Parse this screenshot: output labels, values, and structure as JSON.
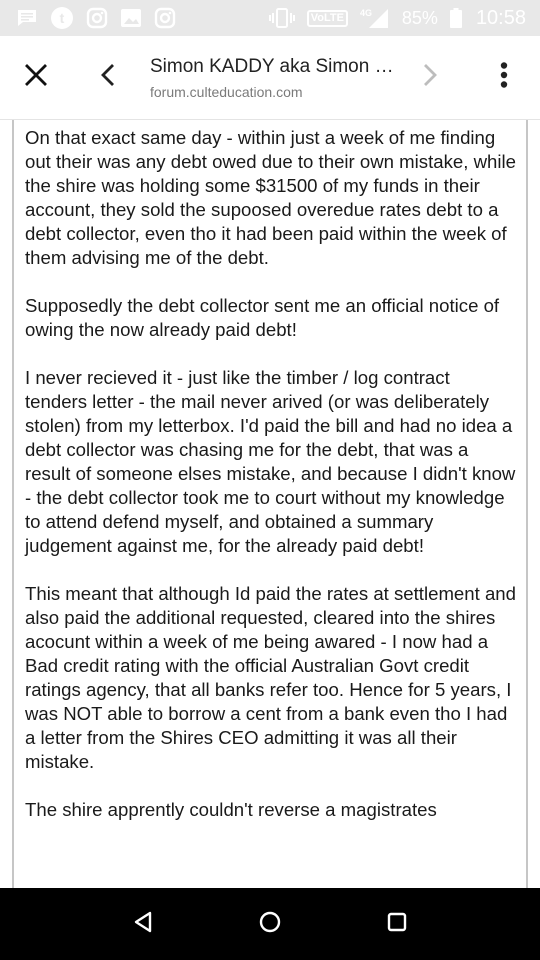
{
  "status_bar": {
    "icons": [
      "message-icon",
      "tumblr-icon",
      "instagram-icon",
      "image-icon",
      "instagram-icon",
      "vibrate-icon",
      "volte-badge",
      "signal-4g-icon",
      "battery-icon"
    ],
    "volte": "VoLTE",
    "network": "4G",
    "battery": "85%",
    "time": "10:58"
  },
  "toolbar": {
    "title": "Simon KADDY aka Simon KADDY",
    "url": "forum.culteducation.com"
  },
  "post": {
    "paragraphs": [
      "On that exact same day - within just a week of me finding out their was any debt owed due to their own mistake, while the shire was holding some $31500 of my funds in their account, they sold the supoosed overedue rates debt to a debt collector, even tho it had been paid within the week of them advising me of the debt.",
      "Supposedly the debt collector sent me an official notice of owing the now already paid debt!",
      "I never recieved it - just like the timber / log contract tenders letter - the mail never arived (or was deliberately stolen) from my letterbox. I'd paid the bill and had no idea a debt collector was chasing me for the debt, that was a result of someone elses mistake, and because I didn't know - the debt collector took me to court without my knowledge to attend defend myself, and obtained a summary judgement against me, for the already paid debt!",
      "This meant that although Id paid the rates at settlement and also paid the additional requested, cleared into the shires acocunt within a week of me being awared - I now had a Bad credit rating with the official Australian Govt credit ratings agency, that all banks refer too. Hence for 5 years, I was NOT able to borrow a cent from a bank even tho I had a letter from the Shires CEO admitting it was all their mistake.",
      "The shire apprently couldn't reverse a magistrates"
    ]
  },
  "nav_bar": {
    "icons": [
      "back-triangle-icon",
      "home-circle-icon",
      "recents-square-icon"
    ]
  }
}
